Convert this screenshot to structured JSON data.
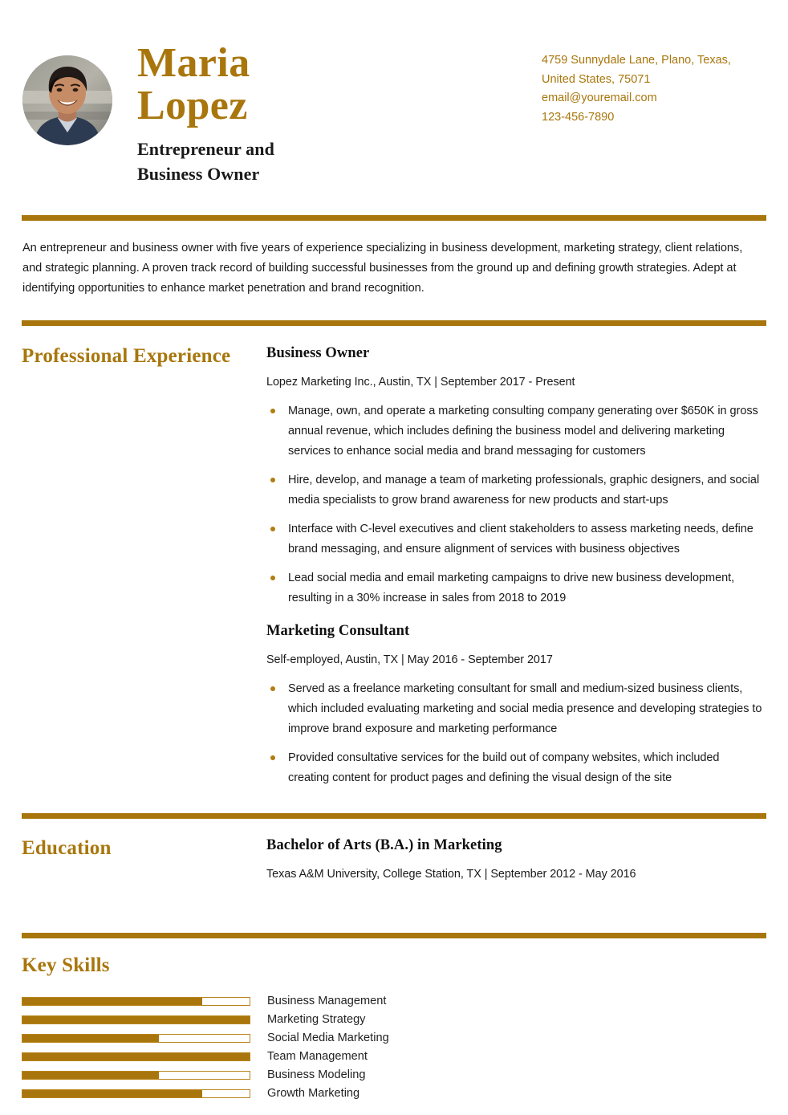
{
  "theme": {
    "accent": "#a8760c",
    "text": "#1a1a1a"
  },
  "header": {
    "first_name": "Maria",
    "last_name": "Lopez",
    "job_title_line1": "Entrepreneur and",
    "job_title_line2": "Business Owner",
    "avatar_alt": "profile-photo"
  },
  "contact": {
    "address_line1": "4759 Sunnydale Lane, Plano, Texas,",
    "address_line2": "United States, 75071",
    "email": "email@youremail.com",
    "phone": "123-456-7890"
  },
  "summary": {
    "text": "An entrepreneur and business owner with five years of experience specializing in business development, marketing strategy, client relations, and strategic planning. A proven track record of building successful businesses from the ground up and defining growth strategies. Adept at identifying opportunities to enhance market penetration and brand recognition."
  },
  "experience": {
    "heading": "Professional Experience",
    "entries": [
      {
        "title": "Business Owner",
        "meta": "Lopez Marketing Inc., Austin, TX | September 2017 - Present",
        "bullets": [
          "Manage, own, and operate a marketing consulting company generating over $650K in gross annual revenue, which includes defining the business model and delivering marketing services to enhance social media and brand messaging for customers",
          "Hire, develop, and manage a team of marketing professionals, graphic designers, and social media specialists to grow brand awareness for new products and start-ups",
          "Interface with C-level executives and client stakeholders to assess marketing needs, define brand messaging, and ensure alignment of services with business objectives",
          "Lead social media and email marketing campaigns to drive new business development, resulting in a 30% increase in sales from 2018 to 2019"
        ]
      },
      {
        "title": "Marketing Consultant",
        "meta": "Self-employed, Austin, TX | May 2016 - September 2017",
        "bullets": [
          "Served as a freelance marketing consultant for small and medium-sized business clients, which included evaluating marketing and social media presence and developing strategies to improve brand exposure and marketing performance",
          "Provided consultative services for the build out of company websites, which included creating content for product pages and defining the visual design of the site"
        ]
      }
    ]
  },
  "education": {
    "heading": "Education",
    "entries": [
      {
        "title": "Bachelor of Arts (B.A.) in Marketing",
        "meta": "Texas A&M University, College Station, TX | September 2012 - May 2016"
      }
    ]
  },
  "skills": {
    "heading": "Key Skills",
    "items": [
      {
        "label": "Business Management",
        "level": 79
      },
      {
        "label": "Marketing Strategy",
        "level": 100
      },
      {
        "label": "Social Media Marketing",
        "level": 60
      },
      {
        "label": "Team Management",
        "level": 100
      },
      {
        "label": "Business Modeling",
        "level": 60
      },
      {
        "label": "Growth Marketing",
        "level": 79
      }
    ]
  }
}
